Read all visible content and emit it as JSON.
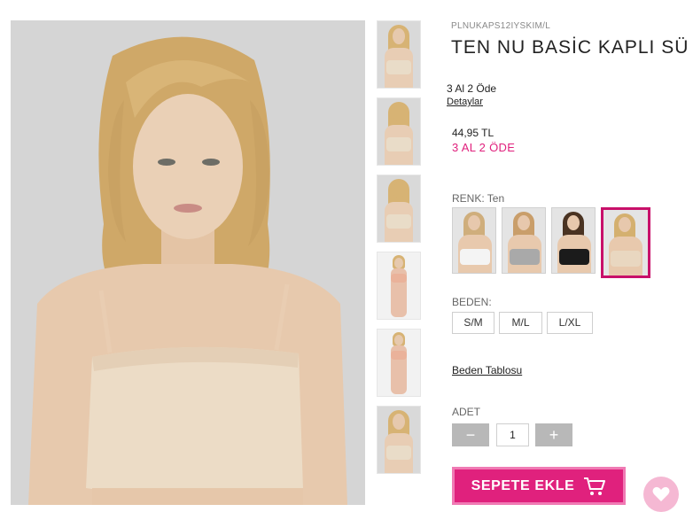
{
  "product": {
    "sku": "PLNUKAPS12IYSKIM/L",
    "title": "TEN NU BASİC KAPLI SÜ",
    "promo_label": "3 Al 2 Öde",
    "details_link": "Detaylar",
    "price": "44,95 TL",
    "promo_price": "3 AL 2 ÖDE"
  },
  "thumbnails": [
    {
      "icon": "model-front-photo"
    },
    {
      "icon": "model-back-photo"
    },
    {
      "icon": "model-back-photo"
    },
    {
      "icon": "model-full-body-photo"
    },
    {
      "icon": "model-full-body-photo"
    },
    {
      "icon": "model-front-photo"
    }
  ],
  "color": {
    "label": "RENK: Ten",
    "swatches": [
      {
        "name": "white",
        "top_color": "#f4f4f4",
        "hair_color": "#cfae7c"
      },
      {
        "name": "grey",
        "top_color": "#a9a9a9",
        "hair_color": "#c99e6a"
      },
      {
        "name": "black",
        "top_color": "#1b1b1b",
        "hair_color": "#4a3322"
      },
      {
        "name": "ten",
        "top_color": "#e9d7c0",
        "hair_color": "#d4b06f",
        "selected": true
      }
    ]
  },
  "size": {
    "label": "BEDEN:",
    "options": [
      "S/M",
      "M/L",
      "L/XL"
    ],
    "table_link": "Beden Tablosu"
  },
  "quantity": {
    "label": "ADET",
    "value": "1",
    "minus": "−",
    "plus": "+"
  },
  "cart": {
    "add_label": "SEPETE EKLE"
  },
  "colors": {
    "accent": "#e0217d",
    "selected_border": "#c8106a",
    "fav_bg": "#f5b8d3"
  }
}
